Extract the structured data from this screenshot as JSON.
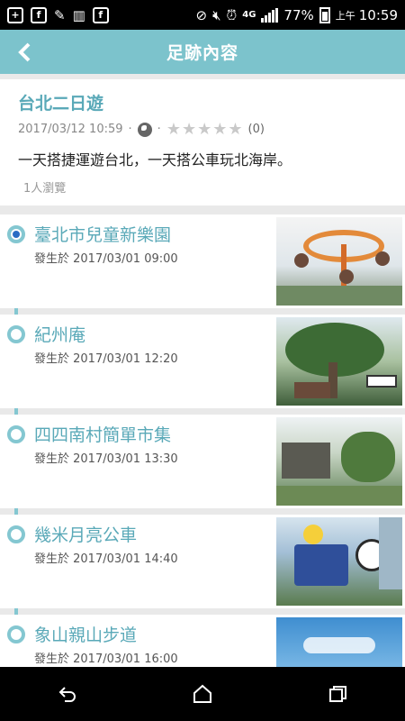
{
  "status_bar": {
    "battery_percent": "77%",
    "network": "4G",
    "time_period": "上午",
    "time": "10:59"
  },
  "header": {
    "title": "足跡內容"
  },
  "trip": {
    "title": "台北二日遊",
    "datetime": "2017/03/12 10:59",
    "rating_count": "(0)",
    "rating_value": 0,
    "rating_max": 5,
    "description": "一天搭捷運遊台北，一天搭公車玩北海岸。",
    "views": "1人瀏覽"
  },
  "timeline": {
    "items": [
      {
        "name": "臺北市兒童新樂園",
        "time": "發生於 2017/03/01  09:00",
        "photo": "amusement-park-photo",
        "active": true
      },
      {
        "name": "紀州庵",
        "time": "發生於 2017/03/01  12:20",
        "photo": "kishu-an-photo",
        "active": false
      },
      {
        "name": "四四南村簡單市集",
        "time": "發生於 2017/03/01  13:30",
        "photo": "military-village-photo",
        "active": false
      },
      {
        "name": "幾米月亮公車",
        "time": "發生於 2017/03/01  14:40",
        "photo": "moon-bus-photo",
        "active": false
      },
      {
        "name": "象山親山步道",
        "time": "發生於 2017/03/01  16:00",
        "photo": "elephant-mountain-photo",
        "active": false
      }
    ]
  },
  "colors": {
    "accent": "#7cc3cc",
    "title_text": "#5aa9b8",
    "timeline_line": "#84c7d1",
    "active_dot": "#2a6cc4"
  }
}
